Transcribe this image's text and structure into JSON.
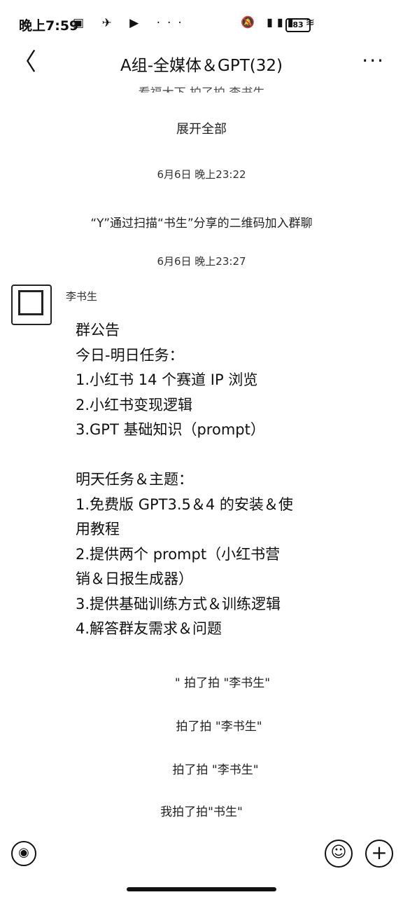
{
  "status_bar": {
    "time": "晚上7:59",
    "left_icons": "▣ ✈ ▶ ···",
    "right_icons": "🔕 ▮▮▮ ≋",
    "battery": "83"
  },
  "header": {
    "back": "〈",
    "title": "A组-全媒体＆GPT(32)",
    "more": "···"
  },
  "messages": {
    "cut_text": "看福大下 拍了拍 李书生",
    "expand_all": "展开全部",
    "time1": "6月6日 晚上23:22",
    "system_join": "“Y”通过扫描“书生”分享的二维码加入群聊",
    "time2": "6月6日 晚上23:27",
    "sender": "李书生",
    "announcement": [
      "群公告",
      "今日-明日任务：",
      "1.小红书 14 个赛道 IP 浏览",
      "2.小红书变现逻辑",
      "3.GPT 基础知识（prompt）",
      "",
      "明天任务＆主题：",
      "1.免费版 GPT3.5＆4 的安装＆使",
      "用教程",
      "2.提供两个 prompt（小红书营",
      "销＆日报生成器）",
      "3.提供基础训练方式＆训练逻辑",
      "4.解答群友需求＆问题"
    ],
    "pat1": "\" 拍了拍 \"李书生\"",
    "pat2": "拍了拍 \"李书生\"",
    "pat3": "拍了拍 \"李书生\"",
    "pat4": "我拍了拍\"书生\""
  },
  "input_bar": {
    "voice_icon": "voice-icon",
    "emoji_icon": "emoji-icon",
    "plus_icon": "plus-icon",
    "voice": "◉",
    "emoji": "☺",
    "plus": "+"
  }
}
